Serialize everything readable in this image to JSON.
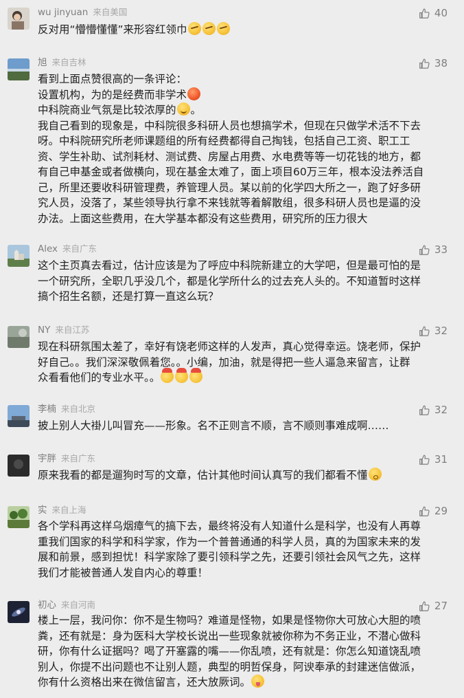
{
  "comments": [
    {
      "nickname": "wu jinyuan",
      "location": "来自美国",
      "likes": "40",
      "lines": [
        "反对用“懵懵懂懂”来形容红领巾"
      ],
      "avatar": "portrait-avatar"
    },
    {
      "nickname": "旭",
      "location": "来自吉林",
      "likes": "38",
      "lines": [
        "看到上面点赞很高的一条评论：",
        "设置机构，为的是经费而非学术",
        "中科院商业气氛是比较浓厚的",
        "我自己看到的现象是，中科院很多科研人员也想搞学术，但现在只做学术活不下去",
        "呀。中科院研究所老师课题组的所有经费都得自己掏钱，包括自己工资、职工工",
        "资、学生补助、试剂耗材、测试费、房屋占用费、水电费等等一切花钱的地方，都",
        "有自己申基金或者做横向，现在基金太难了，面上项目60万三年，根本没法养活自",
        "己，所里还要收科研管理费，养管理人员。某以前的化学四大所之一，跑了好多研",
        "究人员，没落了，某些领导执行拿不来钱就等着解散组，很多科研人员也是逼的没",
        "办法。上面这些费用，在大学基本都没有这些费用，研究所的压力很大"
      ],
      "avatar": "landscape-avatar"
    },
    {
      "nickname": "Alex",
      "location": "来自广东",
      "likes": "33",
      "lines": [
        "这个主页真去看过，估计应该是为了呼应中科院新建立的大学吧，但是最可怕的是",
        "一个研究所，全职几乎没几个，都是化学所什么的过去充人头的。不知道暂时这样",
        "搞个招生名额，还是打算一直这么玩？"
      ],
      "avatar": "castle-avatar"
    },
    {
      "nickname": "NY",
      "location": "来自江苏",
      "likes": "32",
      "lines": [
        "现在科研氛围太差了，幸好有饶老师这样的人发声，真心觉得幸运。饶老师，保护",
        "好自己。。我们深深敬佩着您。。小编，加油，就是得把一些人逼急来留言，让群",
        "众看看他们的专业水平。。"
      ],
      "avatar": "mist-avatar"
    },
    {
      "nickname": "李楠",
      "location": "来自北京",
      "likes": "32",
      "lines": [
        "披上别人大褂儿叫冒充——形象。名不正则言不顺，言不顺则事难成啊……"
      ],
      "avatar": "sky-avatar"
    },
    {
      "nickname": "宇胖",
      "location": "来自广东",
      "likes": "31",
      "lines": [
        "原来我看的都是遛狗时写的文章，估计其他时间认真写的我们都看不懂"
      ],
      "avatar": "dark-avatar"
    },
    {
      "nickname": "实",
      "location": "来自上海",
      "likes": "29",
      "lines": [
        "各个学科再这样乌烟瘴气的搞下去，最终将没有人知道什么是科学，也没有人再尊",
        "重我们国家的科学和科学家，作为一个普普通通的科学人员，真的为国家未来的发",
        "展和前景，感到担忧！科学家除了要引领科学之先，还要引领社会风气之先，这样",
        "我们才能被普通人发自内心的尊重！"
      ],
      "avatar": "trees-avatar"
    },
    {
      "nickname": "初心",
      "location": "来自河南",
      "likes": "27",
      "lines": [
        "楼上一层，我问你：你不是生物吗？难道是怪物，如果是怪物你大可放心大胆的喷",
        "粪，还有就是：身为医科大学校长说出一些现象就被你称为不务正业，不潜心做科",
        "研，你有什么证据吗？喝了开塞露的嘴——你乱喷，还有就是：你怎么知道饶乱喷",
        "别人，你提不出问题也不让别人题，典型的明哲保身，阿谀奉承的封建迷信做派，",
        "你有什么资格出来在微信留言，还大放厥词。"
      ],
      "avatar": "galaxy-avatar"
    }
  ]
}
